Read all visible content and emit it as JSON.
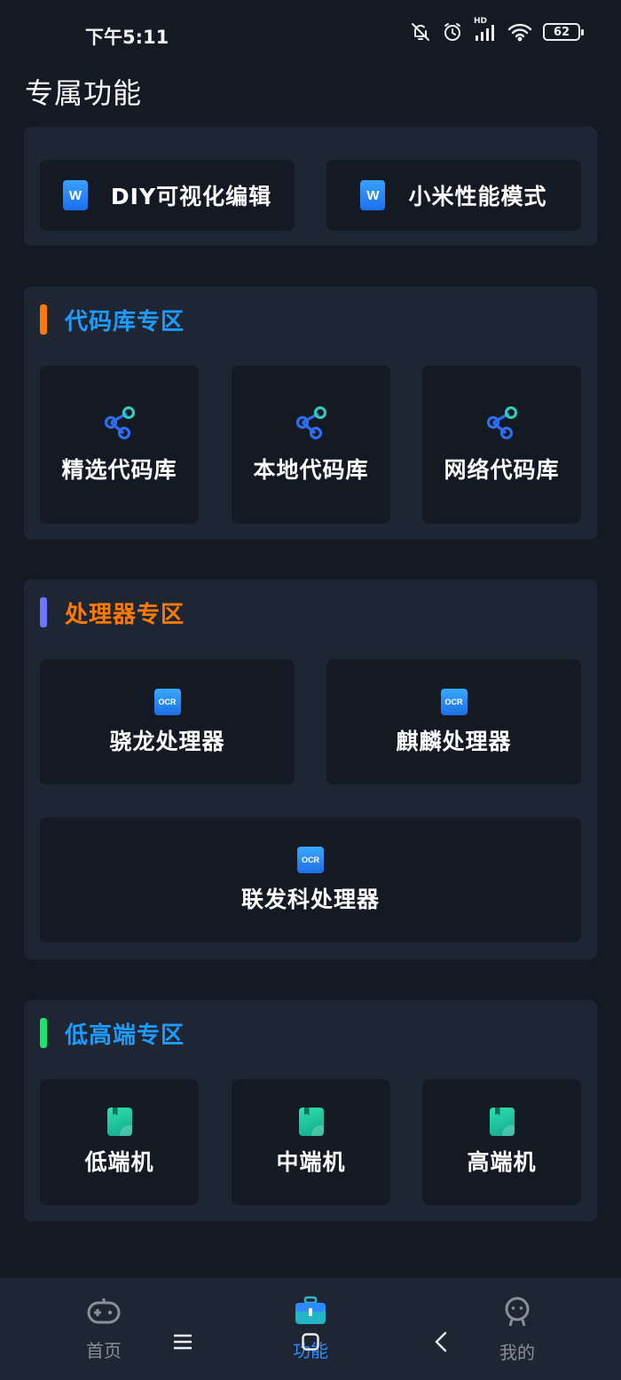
{
  "status_bar": {
    "time": "下午5:11",
    "battery": "62",
    "signal_label": "HD"
  },
  "page_title": "专属功能",
  "top_card": {
    "items": [
      {
        "label": "DIY可视化编辑",
        "icon": "word-doc-icon"
      },
      {
        "label": "小米性能模式",
        "icon": "word-doc-icon"
      }
    ]
  },
  "sections": [
    {
      "title": "代码库专区",
      "bar_color": "#ff7a00",
      "title_color": "#1e9bff",
      "items": [
        {
          "label": "精选代码库",
          "icon": "share-icon"
        },
        {
          "label": "本地代码库",
          "icon": "share-icon"
        },
        {
          "label": "网络代码库",
          "icon": "share-icon"
        }
      ]
    },
    {
      "title": "处理器专区",
      "bar_color": "#6d74ff",
      "title_color": "#ff7a00",
      "items": [
        {
          "label": "骁龙处理器",
          "icon": "ocr-icon"
        },
        {
          "label": "麒麟处理器",
          "icon": "ocr-icon"
        },
        {
          "label": "联发科处理器",
          "icon": "ocr-icon"
        }
      ]
    },
    {
      "title": "低高端专区",
      "bar_color": "#19e36a",
      "title_color": "#1e9bff",
      "items": [
        {
          "label": "低端机",
          "icon": "book-icon"
        },
        {
          "label": "中端机",
          "icon": "book-icon"
        },
        {
          "label": "高端机",
          "icon": "book-icon"
        }
      ]
    }
  ],
  "ocr_text": "OCR",
  "doc_text": "W",
  "bottom_nav": {
    "items": [
      {
        "label": "首页",
        "icon": "gamepad-icon",
        "active": false
      },
      {
        "label": "功能",
        "icon": "toolbox-icon",
        "active": true
      },
      {
        "label": "我的",
        "icon": "robot-face-icon",
        "active": false
      }
    ],
    "active_color": "#2e8bff",
    "inactive_color": "#8a8f99"
  }
}
